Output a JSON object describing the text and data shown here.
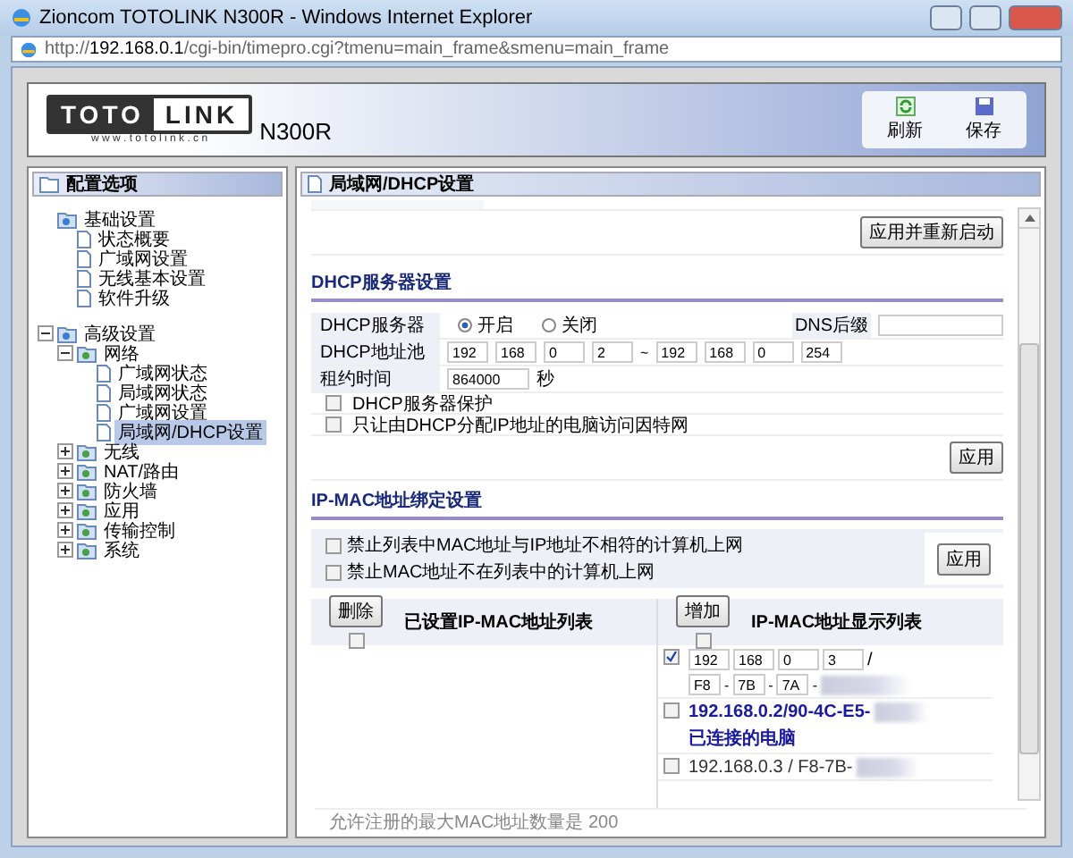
{
  "window": {
    "title": "Zioncom TOTOLINK N300R - Windows Internet Explorer"
  },
  "address_bar": {
    "url": "http://**192.168.0.1**/cgi-bin/timepro.cgi?tmenu=main_frame&smenu=main_frame"
  },
  "header": {
    "logo_left": "TOTO",
    "logo_right": "LINK",
    "logo_url": "w w w . t o t o l i n k . c n",
    "model": "N300R",
    "toolbar": [
      {
        "kind": "refresh",
        "label": "刷新"
      },
      {
        "kind": "save",
        "label": "保存"
      }
    ]
  },
  "sidebar": {
    "title": "配置选项",
    "tree": [
      {
        "label": "基础设置",
        "selected": false,
        "children": [
          {
            "label": "状态概要",
            "selected": false
          },
          {
            "label": "广域网设置",
            "selected": false
          },
          {
            "label": "无线基本设置",
            "selected": false
          },
          {
            "label": "软件升级",
            "selected": false
          }
        ]
      },
      {
        "label": "高级设置",
        "selected": false,
        "expanded": true,
        "children": [
          {
            "label": "网络",
            "selected": false,
            "expanded": true,
            "children": [
              {
                "label": "广域网状态",
                "selected": false
              },
              {
                "label": "局域网状态",
                "selected": false
              },
              {
                "label": "广域网设置",
                "selected": false
              },
              {
                "label": "局域网/DHCP设置",
                "selected": true
              }
            ]
          },
          {
            "label": "无线",
            "selected": false,
            "expanded": false
          },
          {
            "label": "NAT/路由",
            "selected": false,
            "expanded": false
          },
          {
            "label": "防火墙",
            "selected": false,
            "expanded": false
          },
          {
            "label": "应用",
            "selected": false,
            "expanded": false
          },
          {
            "label": "传输控制",
            "selected": false,
            "expanded": false
          },
          {
            "label": "系统",
            "selected": false,
            "expanded": false
          }
        ]
      }
    ]
  },
  "content": {
    "title": "局域网/DHCP设置",
    "restart_button": "应用并重新启动",
    "dhcp": {
      "heading": "DHCP服务器设置",
      "server_label": "DHCP服务器",
      "modes": [
        {
          "label": "开启",
          "selected": true
        },
        {
          "label": "关闭",
          "selected": false
        }
      ],
      "dns_label": "DNS后缀",
      "pool_label": "DHCP地址池",
      "pool_start": [
        "192",
        "168",
        "0",
        "2"
      ],
      "pool_sep": "~",
      "pool_end": [
        "192",
        "168",
        "0",
        "254"
      ],
      "lease_label": "租约时间",
      "lease_value": "864000",
      "lease_unit": "秒",
      "options": [
        {
          "label": "DHCP服务器保护",
          "checked": false
        },
        {
          "label": "只让由DHCP分配IP地址的电脑访问因特网",
          "checked": false
        }
      ],
      "apply": "应用"
    },
    "binding": {
      "heading": "IP-MAC地址绑定设置",
      "options": [
        {
          "label": "禁止列表中MAC地址与IP地址不相符的计算机上网",
          "checked": false
        },
        {
          "label": "禁止MAC地址不在列表中的计算机上网",
          "checked": false
        }
      ],
      "apply": "应用",
      "set_list": {
        "button": "删除",
        "title": "已设置IP-MAC地址列表",
        "all_checked": false
      },
      "show_list": {
        "button": "增加",
        "title": "IP-MAC地址显示列表",
        "all_checked": false,
        "entries": [
          {
            "kind": "edit",
            "checked": true,
            "ip": [
              "192",
              "168",
              "0",
              "3"
            ],
            "slash": "/",
            "mac": [
              "F8",
              "7B",
              "7A"
            ],
            "mac_sep": "-"
          },
          {
            "kind": "connected",
            "checked": false,
            "text": "192.168.0.2/90-4C-E5-",
            "note": "已连接的电脑"
          },
          {
            "kind": "plain",
            "checked": false,
            "text": "192.168.0.3 / F8-7B-"
          }
        ]
      }
    },
    "footer": "允许注册的最大MAC地址数量是  200"
  }
}
